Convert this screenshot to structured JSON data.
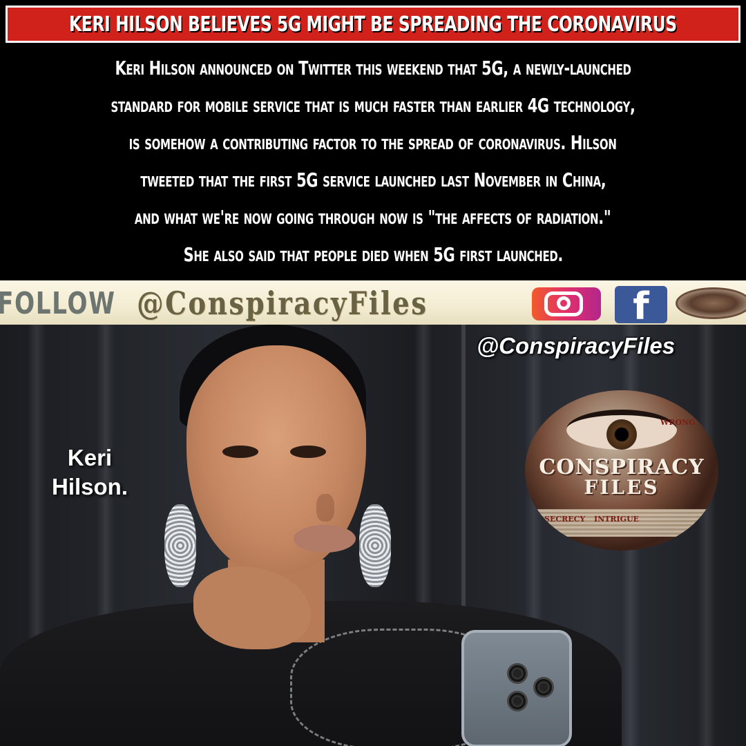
{
  "headline": "KERI HILSON BELIEVES 5G MIGHT BE SPREADING THE CORONAVIRUS",
  "body_lines": [
    "Keri Hilson announced on Twitter this weekend that 5G, a newly-launched",
    "standard for mobile service that is much faster than earlier 4G technology,",
    "is somehow a contributing factor to the spread of coronavirus. Hilson",
    "tweeted that the first 5G service launched last November in China,",
    "and what we're now going through now is \"the affects of radiation.\"",
    "She also said that people died when 5G first launched."
  ],
  "follow_banner": {
    "follow_text": "FOLLOW",
    "handle_text": "@ConspiracyFiles",
    "icons": [
      "instagram-icon",
      "facebook-icon",
      "conspiracy-files-logo"
    ]
  },
  "photo": {
    "caption_name_line1": "Keri",
    "caption_name_line2": "Hilson.",
    "handle_overlay": "@ConspiracyFiles",
    "logo": {
      "title_line1": "CONSPIRACY",
      "title_line2": "FILES",
      "word_wrong": "WRONG",
      "word_secrecy": "SECRECY",
      "word_intrigue": "INTRIGUE"
    }
  },
  "colors": {
    "headline_bg": "#d0211b",
    "background": "#000000",
    "text": "#ffffff",
    "banner_bg": "#f3ecd2"
  }
}
